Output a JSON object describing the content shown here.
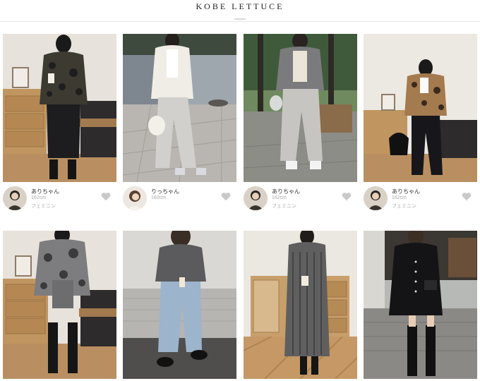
{
  "header": {
    "brand": "KOBE LETTUCE"
  },
  "cards": [
    {
      "name": "ありちゃん",
      "height": "162cm",
      "tag": "フェミニン"
    },
    {
      "name": "りっちゃん",
      "height": "160cm",
      "tag": ""
    },
    {
      "name": "ありちゃん",
      "height": "162cm",
      "tag": "フェミニン"
    },
    {
      "name": "ありちゃん",
      "height": "162cm",
      "tag": "フェミニン"
    },
    {
      "name": "",
      "height": "",
      "tag": ""
    },
    {
      "name": "",
      "height": "",
      "tag": ""
    },
    {
      "name": "",
      "height": "",
      "tag": ""
    },
    {
      "name": "",
      "height": "",
      "tag": ""
    }
  ],
  "icons": {
    "like": "heart-icon"
  },
  "colors": {
    "heart": "#c9c9c9",
    "accent": "#222222"
  }
}
